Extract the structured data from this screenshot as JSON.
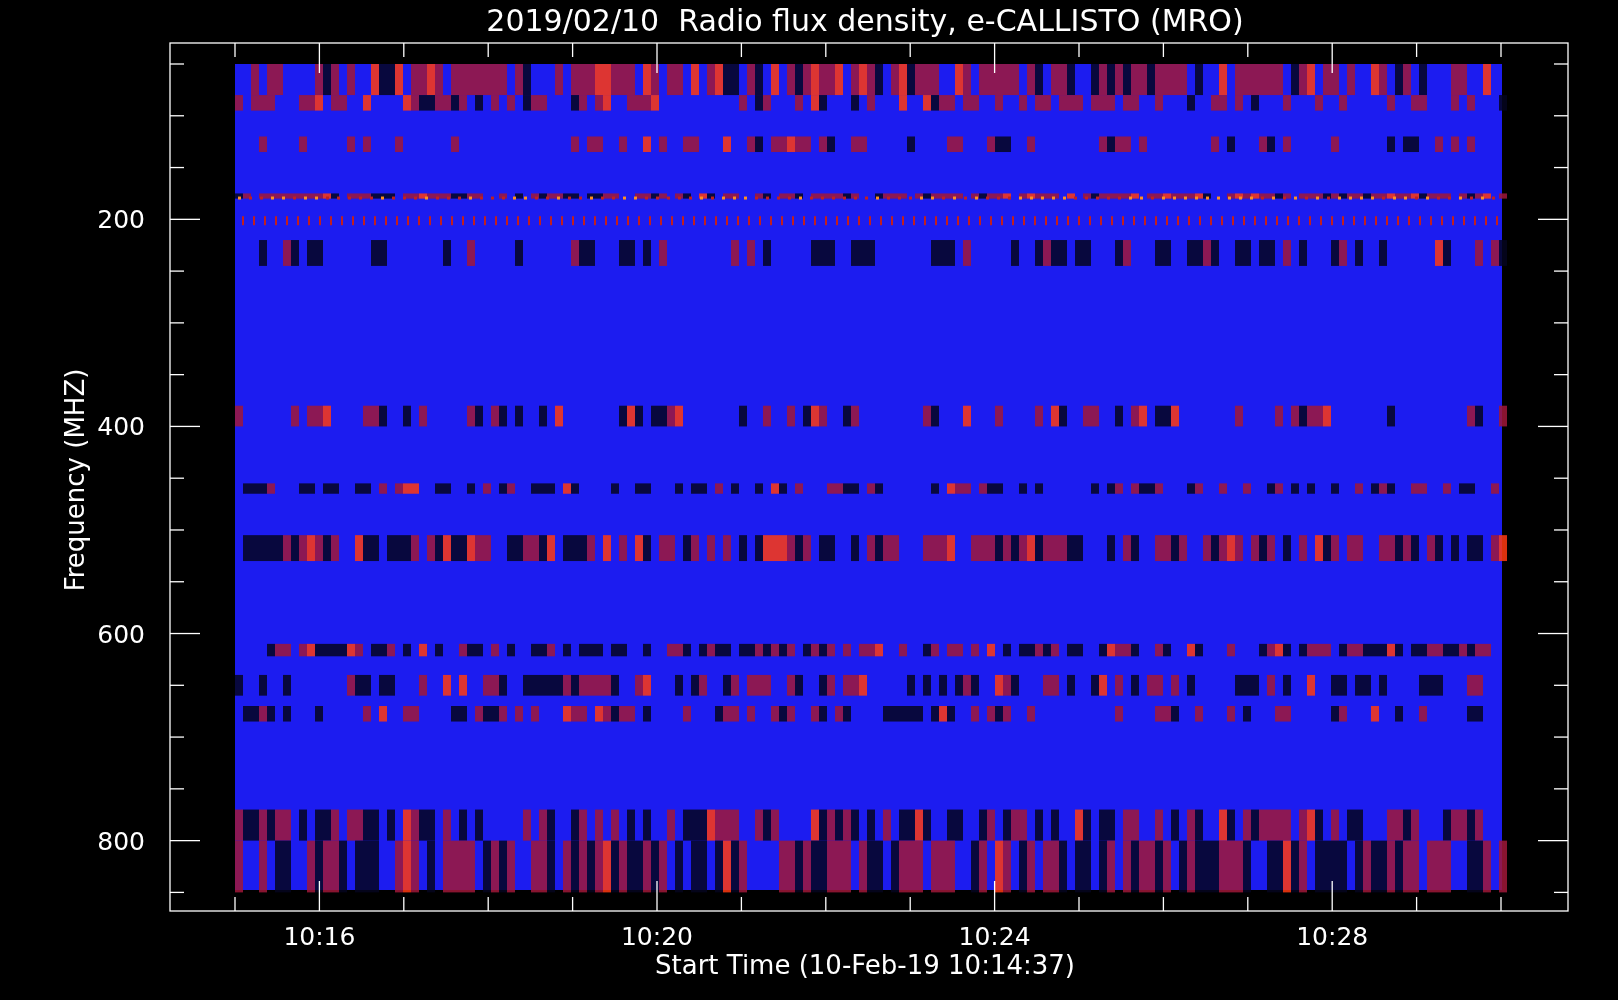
{
  "plot": {
    "title": "2019/02/10  Radio flux density, e-CALLISTO (MRO)",
    "xlabel": "Start Time (10-Feb-19 10:14:37)",
    "ylabel": "Frequency (MHZ)",
    "x_ticks": [
      "10:16",
      "10:20",
      "10:24",
      "10:28"
    ],
    "y_ticks": [
      "200",
      "400",
      "600",
      "800"
    ]
  }
}
